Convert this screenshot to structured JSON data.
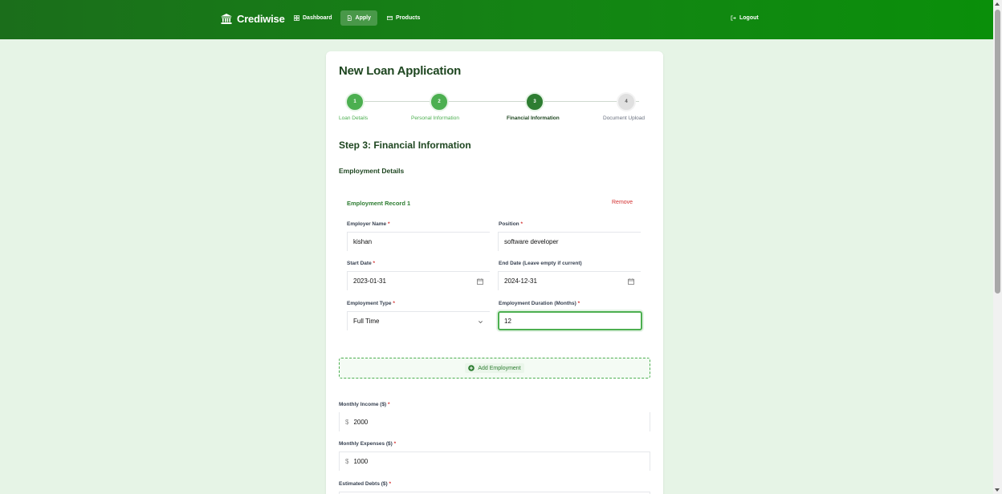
{
  "nav": {
    "brand": "Crediwise",
    "dashboard": "Dashboard",
    "apply": "Apply",
    "products": "Products",
    "logout": "Logout"
  },
  "page": {
    "title": "New Loan Application",
    "step_title": "Step 3: Financial Information",
    "section_title": "Employment Details"
  },
  "steps": [
    {
      "number": "1",
      "label": "Loan Details",
      "state": "done"
    },
    {
      "number": "2",
      "label": "Personal Information",
      "state": "done"
    },
    {
      "number": "3",
      "label": "Financial Information",
      "state": "active"
    },
    {
      "number": "4",
      "label": "Document Upload",
      "state": "todo"
    }
  ],
  "employment": {
    "record_title": "Employment Record 1",
    "remove_label": "Remove",
    "employer_name_label": "Employer Name",
    "employer_name_value": "kishan",
    "position_label": "Position",
    "position_value": "software developer",
    "start_date_label": "Start Date",
    "start_date_value": "2023-01-31",
    "end_date_label": "End Date (Leave empty if current)",
    "end_date_value": "2024-12-31",
    "employment_type_label": "Employment Type",
    "employment_type_value": "Full Time",
    "duration_label": "Employment Duration (Months)",
    "duration_value": "12",
    "add_employment_label": "Add Employment"
  },
  "financial": {
    "monthly_income_label": "Monthly Income ($)",
    "monthly_income_value": "2000",
    "monthly_expenses_label": "Monthly Expenses ($)",
    "monthly_expenses_value": "1000",
    "estimated_debts_label": "Estimated Debts ($)",
    "currency_prefix": "$"
  },
  "required_marker": "*",
  "colors": {
    "header": "#148414",
    "primary": "#4caf50",
    "primary_dark": "#2e7d32",
    "background": "#e6f4e6",
    "danger": "#d32f2f"
  }
}
